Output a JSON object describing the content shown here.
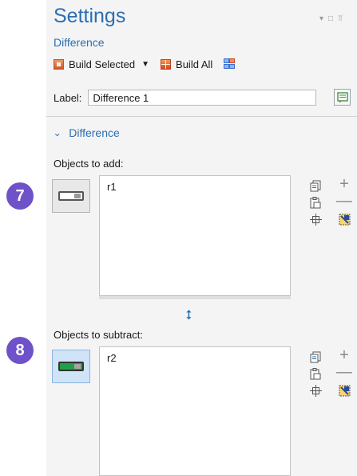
{
  "header": {
    "title": "Settings",
    "subtitle": "Difference",
    "window_controls": [
      "chevron-down-icon",
      "restore-icon",
      "pin-icon"
    ]
  },
  "toolbar": {
    "build_selected": "Build Selected",
    "build_all": "Build All"
  },
  "label_field": {
    "caption": "Label:",
    "value": "Difference 1"
  },
  "section": {
    "title": "Difference",
    "expanded": true
  },
  "objects_to_add": {
    "caption": "Objects to add:",
    "step": "7",
    "items": [
      "r1"
    ],
    "selection_active": false
  },
  "objects_to_subtract": {
    "caption": "Objects to subtract:",
    "step": "8",
    "items": [
      "r2"
    ],
    "selection_active": true
  },
  "colors": {
    "accent": "#2a6fb2",
    "step_badge": "#6f52c9",
    "active_selection": "#cfe4f7"
  }
}
